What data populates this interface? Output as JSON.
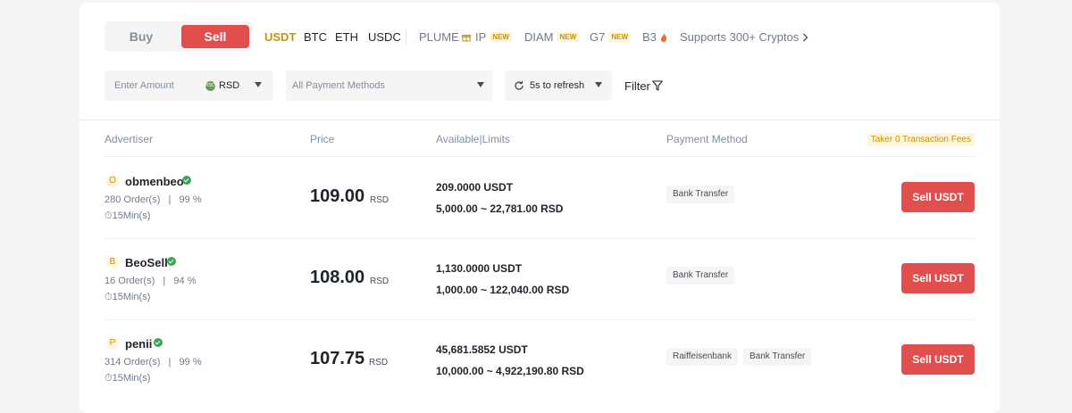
{
  "toggle": {
    "buy": "Buy",
    "sell": "Sell"
  },
  "coins": [
    {
      "label": "USDT"
    },
    {
      "label": "BTC"
    },
    {
      "label": "ETH"
    },
    {
      "label": "USDC"
    },
    {
      "label": "PLUME",
      "icon": "gift-icon"
    },
    {
      "label": "IP",
      "badge": "NEW"
    },
    {
      "label": "DIAM",
      "badge": "NEW"
    },
    {
      "label": "G7",
      "badge": "NEW"
    },
    {
      "label": "B3",
      "icon": "fire-icon"
    }
  ],
  "supports_link": "Supports 300+ Cryptos",
  "filters": {
    "amount_placeholder": "Enter Amount",
    "currency": "RSD",
    "payment_placeholder": "All Payment Methods",
    "refresh": "5s to refresh",
    "filter": "Filter"
  },
  "table": {
    "headers": [
      "Advertiser",
      "Price",
      "Available|Limits",
      "Payment Method"
    ],
    "fee_badge": "Taker 0 Transaction Fees",
    "rows": [
      {
        "initial": "O",
        "name": "obmenbeo",
        "stats": "280 Order(s)   |   99 %",
        "time": "15Min(s)",
        "price": "109.00",
        "price_currency": "RSD",
        "available": "209.0000 USDT",
        "limits": "5,000.00 ~ 22,781.00 RSD",
        "payment_methods": [
          "Bank Transfer"
        ],
        "action": "Sell USDT"
      },
      {
        "initial": "B",
        "name": "BeoSell",
        "stats": "16 Order(s)   |   94 %",
        "time": "15Min(s)",
        "price": "108.00",
        "price_currency": "RSD",
        "available": "1,130.0000 USDT",
        "limits": "1,000.00 ~ 122,040.00 RSD",
        "payment_methods": [
          "Bank Transfer"
        ],
        "action": "Sell USDT"
      },
      {
        "initial": "P",
        "name": "penii",
        "stats": "314 Order(s)   |   99 %",
        "time": "15Min(s)",
        "price": "107.75",
        "price_currency": "RSD",
        "available": "45,681.5852 USDT",
        "limits": "10,000.00 ~ 4,922,190.80 RSD",
        "payment_methods": [
          "Raiffeisenbank",
          "Bank Transfer"
        ],
        "action": "Sell USDT"
      }
    ]
  },
  "colors": {
    "accent": "#c99400",
    "sell": "#e04e4e",
    "verified": "#3aa656"
  }
}
